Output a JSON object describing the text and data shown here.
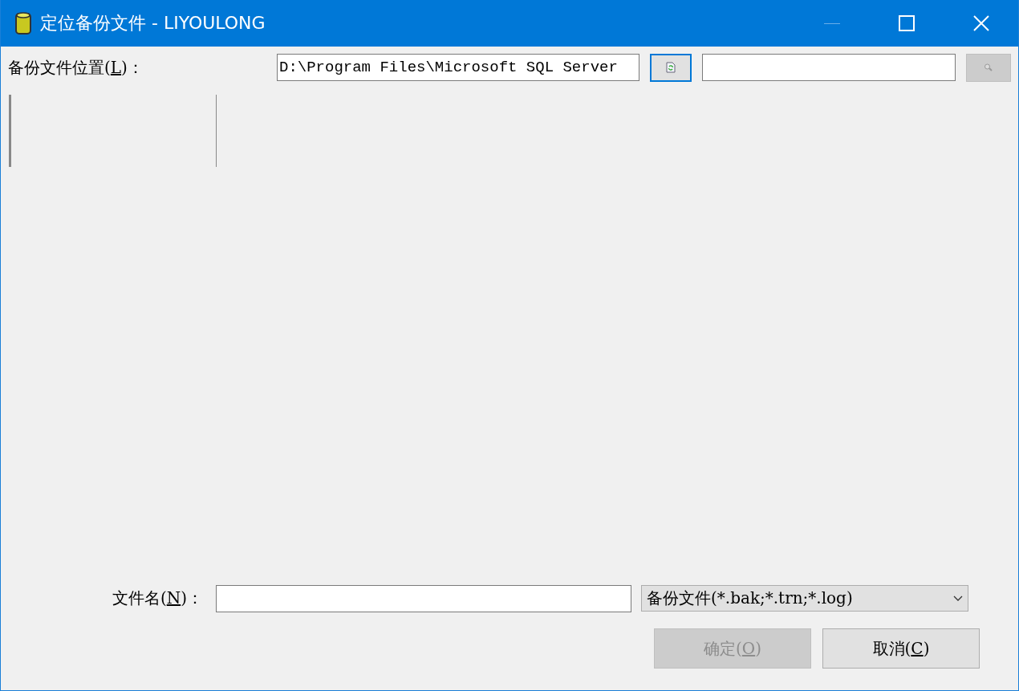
{
  "window": {
    "title": "定位备份文件 - LIYOULONG"
  },
  "location": {
    "label": {
      "before": "备份文件位置(",
      "key": "L",
      "after": ")："
    },
    "value": "D:\\Program Files\\Microsoft SQL Server"
  },
  "refresh_button": {
    "focused": true
  },
  "search_button": {
    "disabled": true
  },
  "file_name": {
    "label": {
      "before": "文件名(",
      "key": "N",
      "after": ")："
    }
  },
  "file_type": {
    "value": "备份文件(*.bak;*.trn;*.log)"
  },
  "buttons": [
    {
      "label": {
        "before": "确定(",
        "key": "O",
        "after": ")"
      },
      "disabled": true
    },
    {
      "label": {
        "before": "取消(",
        "key": "C",
        "after": ")"
      },
      "disabled": false
    }
  ]
}
